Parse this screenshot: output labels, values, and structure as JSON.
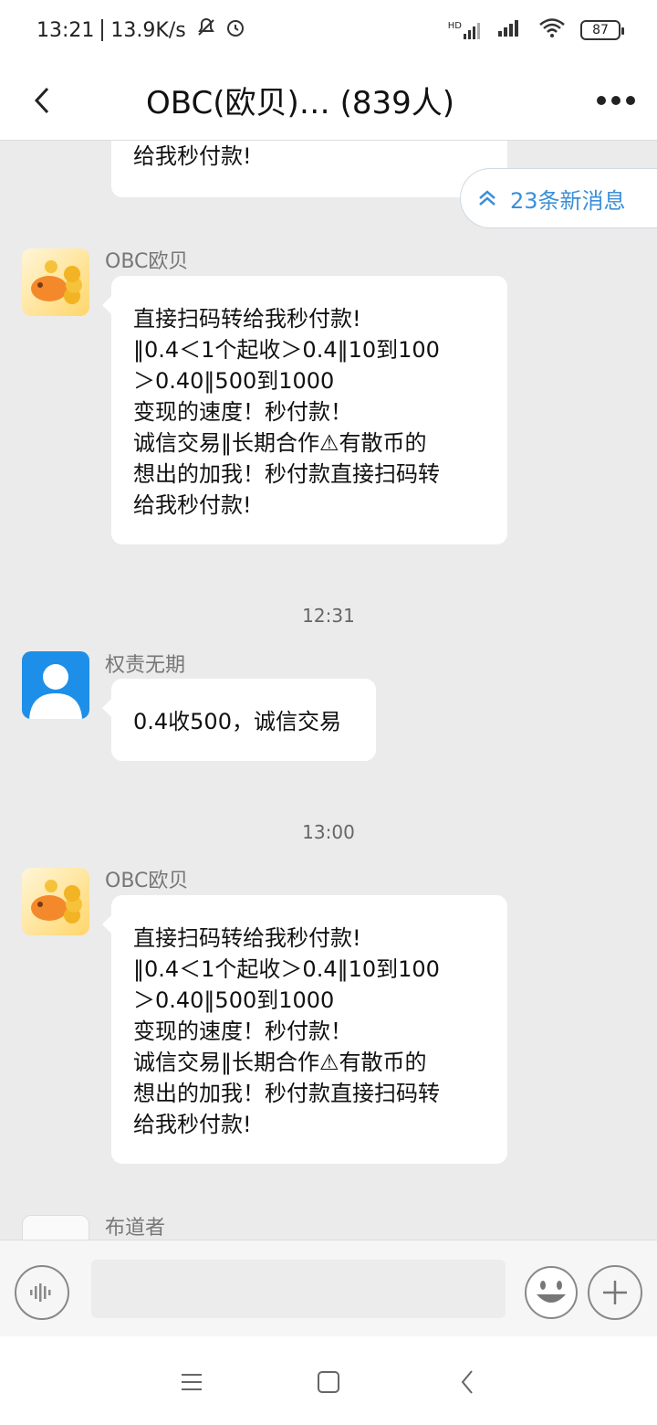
{
  "status": {
    "time": "13:21",
    "speed": "13.9K/s",
    "network": "HD",
    "battery": "87"
  },
  "header": {
    "title": "OBC(欧贝)… (839人)"
  },
  "new_messages": {
    "label": "23条新消息"
  },
  "partial_top": {
    "text": "给我秒付款!"
  },
  "messages": [
    {
      "sender": "OBC欧贝",
      "text": "直接扫码转给我秒付款!\n‖0.4＜1个起收＞0.4‖10到100\n＞0.40‖500到1000\n变现的速度！秒付款！\n诚信交易‖长期合作⚠有散币的\n想出的加我！秒付款直接扫码转\n给我秒付款!"
    },
    {
      "time": "12:31",
      "sender": "权责无期",
      "text": "0.4收500，诚信交易"
    },
    {
      "time": "13:00",
      "sender": "OBC欧贝",
      "text": "直接扫码转给我秒付款!\n‖0.4＜1个起收＞0.4‖10到100\n＞0.40‖500到1000\n变现的速度！秒付款！\n诚信交易‖长期合作⚠有散币的\n想出的加我！秒付款直接扫码转\n给我秒付款!"
    },
    {
      "sender": "布道者"
    }
  ],
  "colors": {
    "accent": "#3b8fd9",
    "background": "#ebebeb",
    "bubble": "#ffffff"
  }
}
